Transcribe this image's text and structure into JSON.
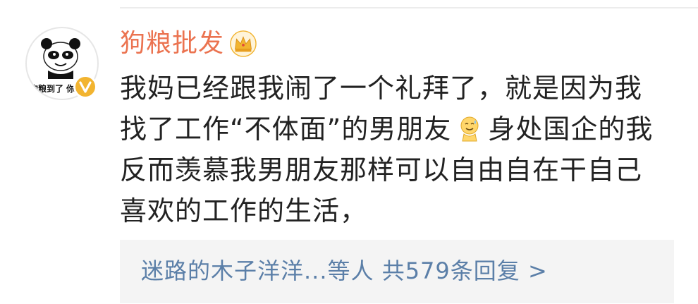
{
  "comment": {
    "username": "狗粮批发",
    "avatar_caption": "狗粮到了 你",
    "lines": [
      "我妈已经跟我闹了一个礼拜了，就是因为我",
      "找了工作“不体面”的男朋友",
      "身处国企的我",
      "反而羡慕我男朋友那样可以自由自在干自己",
      "喜欢的工作的生活，"
    ],
    "emoji_icon": "sweat-smile-emoji-icon",
    "badge_icon": "crown-icon",
    "verified_icon": "verified-v-icon"
  },
  "replies": {
    "summary": "迷路的木子洋洋...等人  共579条回复 >"
  },
  "colors": {
    "username": "#eb7350",
    "link": "#5b7fa8",
    "badge": "#f2b430",
    "reply_bg": "#f4f4f4"
  }
}
